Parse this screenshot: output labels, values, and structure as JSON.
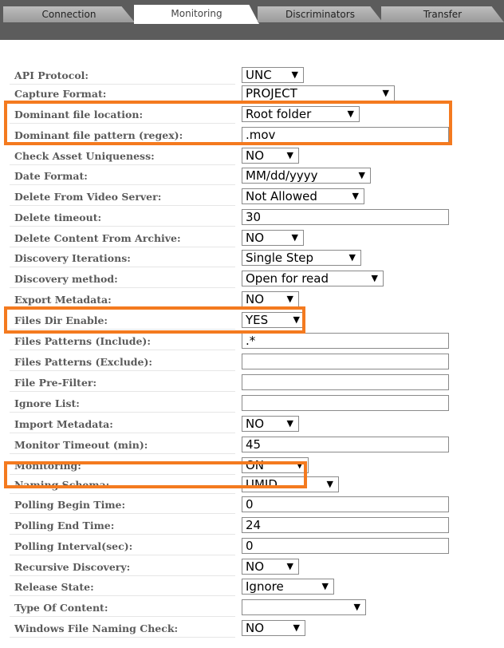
{
  "tabs": [
    {
      "label": "Connection"
    },
    {
      "label": "Monitoring"
    },
    {
      "label": "Discriminators"
    },
    {
      "label": "Transfer"
    }
  ],
  "fields": [
    {
      "label": "API Protocol:",
      "type": "select",
      "value": "UNC"
    },
    {
      "label": "Capture Format:",
      "type": "select",
      "value": "PROJECT"
    },
    {
      "label": "Dominant file location:",
      "type": "select",
      "value": "Root folder"
    },
    {
      "label": "Dominant file pattern (regex):",
      "type": "input",
      "value": ".mov"
    },
    {
      "label": "Check Asset Uniqueness:",
      "type": "select",
      "value": "NO"
    },
    {
      "label": "Date Format:",
      "type": "select",
      "value": "MM/dd/yyyy"
    },
    {
      "label": "Delete From Video Server:",
      "type": "select",
      "value": "Not Allowed"
    },
    {
      "label": "Delete timeout:",
      "type": "input",
      "value": "30"
    },
    {
      "label": "Delete Content From Archive:",
      "type": "select",
      "value": "NO"
    },
    {
      "label": "Discovery Iterations:",
      "type": "select",
      "value": "Single Step"
    },
    {
      "label": "Discovery method:",
      "type": "select",
      "value": "Open for read"
    },
    {
      "label": "Export Metadata:",
      "type": "select",
      "value": "NO"
    },
    {
      "label": "Files Dir Enable:",
      "type": "select",
      "value": "YES"
    },
    {
      "label": "Files Patterns (Include):",
      "type": "input",
      "value": ".*"
    },
    {
      "label": "Files Patterns (Exclude):",
      "type": "input",
      "value": ""
    },
    {
      "label": "File Pre-Filter:",
      "type": "input",
      "value": ""
    },
    {
      "label": "Ignore List:",
      "type": "input",
      "value": ""
    },
    {
      "label": "Import Metadata:",
      "type": "select",
      "value": "NO"
    },
    {
      "label": "Monitor Timeout (min):",
      "type": "input",
      "value": "45"
    },
    {
      "label": "Monitoring:",
      "type": "select",
      "value": "ON"
    },
    {
      "label": "Naming Schema:",
      "type": "select",
      "value": "UMID"
    },
    {
      "label": "Polling Begin Time:",
      "type": "input",
      "value": "0"
    },
    {
      "label": "Polling End Time:",
      "type": "input",
      "value": "24"
    },
    {
      "label": "Polling Interval(sec):",
      "type": "input",
      "value": "0"
    },
    {
      "label": "Recursive Discovery:",
      "type": "select",
      "value": "NO"
    },
    {
      "label": "Release State:",
      "type": "select",
      "value": "Ignore"
    },
    {
      "label": "Type Of Content:",
      "type": "select",
      "value": ""
    },
    {
      "label": "Windows File Naming Check:",
      "type": "select",
      "value": "NO"
    }
  ],
  "highlight_color": "#f47a1f",
  "dropdown_icon": "triangle-down"
}
